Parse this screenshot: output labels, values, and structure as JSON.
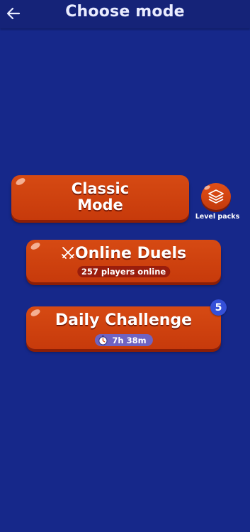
{
  "header": {
    "title": "Choose mode",
    "back_icon": "arrow-left-icon"
  },
  "modes": {
    "classic": {
      "label_line1": "Classic",
      "label_line2": "Mode"
    },
    "online_duels": {
      "label": "Online Duels",
      "icon": "crossed-swords-icon",
      "players_online": "257 players online"
    },
    "daily_challenge": {
      "label": "Daily Challenge",
      "icon": "stopwatch-icon",
      "timer": "7h 38m",
      "badge_count": "5"
    }
  },
  "level_packs": {
    "label": "Level packs",
    "icon": "layers-icon"
  },
  "colors": {
    "background": "#16288a",
    "header": "#152378",
    "button": "#d2440f",
    "badge": "#3550d8",
    "timer_pill": "#6f63c2"
  }
}
